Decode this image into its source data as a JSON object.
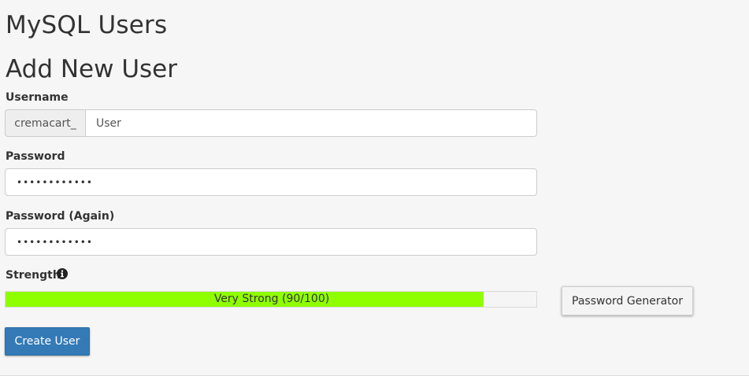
{
  "page": {
    "title": "MySQL Users",
    "section_title": "Add New User"
  },
  "form": {
    "username": {
      "label": "Username",
      "prefix": "cremacart_",
      "value": "User"
    },
    "password": {
      "label": "Password",
      "value": "••••••••••••"
    },
    "password_again": {
      "label": "Password (Again)",
      "value": "••••••••••••"
    },
    "strength": {
      "label": "Strength",
      "info_icon": "info-circle-icon",
      "text": "Very Strong (90/100)",
      "score": 90,
      "max": 100,
      "fill_color": "#8fff00"
    },
    "password_generator_label": "Password Generator",
    "create_user_label": "Create User"
  },
  "colors": {
    "primary_button": "#337ab7",
    "background": "#f6f6f6"
  }
}
